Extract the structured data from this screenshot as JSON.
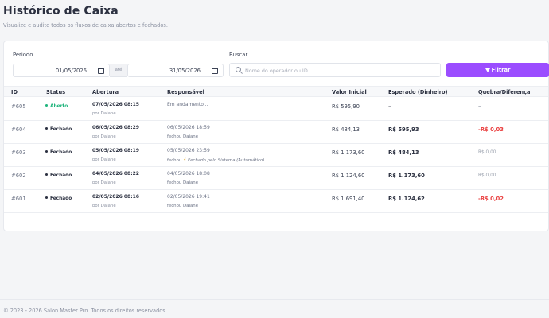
{
  "header": {
    "title": "Histórico de Caixa",
    "subtitle": "Visualize e audite todos os fluxos de caixa abertos e fechados."
  },
  "filters": {
    "period_label": "Período",
    "date_from": "01/05/2026",
    "between_label": "até",
    "date_to": "31/05/2026",
    "search_label": "Buscar",
    "search_placeholder": "Nome do operador ou ID...",
    "filter_button": "Filtrar"
  },
  "table": {
    "columns": [
      "ID",
      "Status",
      "Abertura",
      "Responsável",
      "Valor Inicial",
      "Esperado (Dinheiro)",
      "Quebra/Diferença"
    ],
    "rows": [
      {
        "id": "#605",
        "status": "Aberto",
        "opened_at": "07/05/2026 08:15",
        "opened_by": "por Daiane",
        "resp_line1": "Em andamento...",
        "resp_line2": "",
        "resp_auto": "",
        "initial": "R$ 595,90",
        "expected": "–",
        "diff": "–"
      },
      {
        "id": "#604",
        "status": "Fechado",
        "opened_at": "06/05/2026 08:29",
        "opened_by": "por Daiane",
        "resp_line1": "06/05/2026 18:59",
        "resp_line2": "fechou Daiane",
        "resp_auto": "",
        "initial": "R$ 484,13",
        "expected": "R$ 595,93",
        "diff": "-R$ 0,03"
      },
      {
        "id": "#603",
        "status": "Fechado",
        "opened_at": "05/05/2026 08:19",
        "opened_by": "por Daiane",
        "resp_line1": "05/05/2026 23:59",
        "resp_line2": "fechou",
        "resp_auto": "Fechado pelo Sistema (Automático)",
        "initial": "R$ 1.173,60",
        "expected": "R$ 484,13",
        "diff": "R$ 0,00"
      },
      {
        "id": "#602",
        "status": "Fechado",
        "opened_at": "04/05/2026 08:22",
        "opened_by": "por Daiane",
        "resp_line1": "04/05/2026 18:08",
        "resp_line2": "fechou Daiane",
        "resp_auto": "",
        "initial": "R$ 1.124,60",
        "expected": "R$ 1.173,60",
        "diff": "R$ 0,00"
      },
      {
        "id": "#601",
        "status": "Fechado",
        "opened_at": "02/05/2026 08:16",
        "opened_by": "por Daiane",
        "resp_line1": "02/05/2026 19:41",
        "resp_line2": "fechou Daiane",
        "resp_auto": "",
        "initial": "R$ 1.691,40",
        "expected": "R$ 1.124,62",
        "diff": "-R$ 0,02"
      }
    ]
  },
  "footer": {
    "text": "© 2023 - 2026 Salon Master Pro. Todos os direitos reservados."
  },
  "colors": {
    "accent": "#9b4dff",
    "open": "#1fb47c",
    "negative": "#ea4040"
  }
}
